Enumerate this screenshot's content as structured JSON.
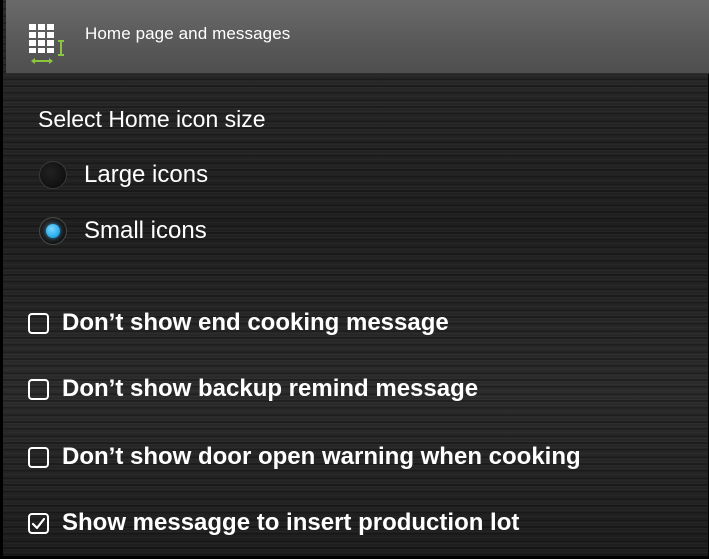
{
  "header": {
    "title": "Home page and messages",
    "icon": "grid-resize-icon"
  },
  "icon_size": {
    "title": "Select Home icon size",
    "options": [
      {
        "label": "Large icons",
        "selected": false
      },
      {
        "label": "Small icons",
        "selected": true
      }
    ]
  },
  "messages": {
    "options": [
      {
        "label": "Don’t show end cooking message",
        "checked": false
      },
      {
        "label": "Don’t show backup remind message",
        "checked": false
      },
      {
        "label": "Don’t show door open warning when cooking",
        "checked": false
      },
      {
        "label": "Show messagge to insert production lot",
        "checked": true
      }
    ]
  },
  "colors": {
    "accent": "#34b3ef",
    "titlebar": "#5a5a5a",
    "background": "#222222",
    "icon_green": "#8cc63f"
  }
}
